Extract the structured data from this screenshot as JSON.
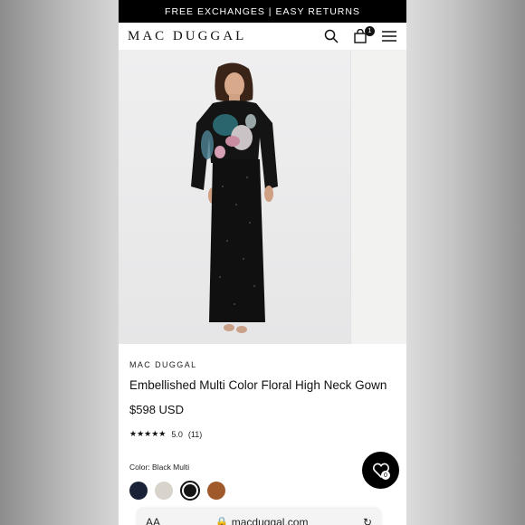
{
  "promo": {
    "text": "FREE EXCHANGES | EASY RETURNS"
  },
  "header": {
    "logo": "MAC DUGGAL",
    "cart_count": "1",
    "icons": [
      "search-icon",
      "cart-icon",
      "menu-icon"
    ]
  },
  "product": {
    "brand": "MAC DUGGAL",
    "title": "Embellished Multi Color Floral High Neck Gown",
    "price": "$598 USD",
    "stars": "★★★★★",
    "rating_value": "5.0",
    "review_count": "(11)",
    "color_label": "Color: Black Multi",
    "swatches": [
      {
        "name": "navy",
        "color": "#1a2238"
      },
      {
        "name": "silver",
        "color": "#d8d4cc"
      },
      {
        "name": "black-multi",
        "color": "#151515",
        "selected": true
      },
      {
        "name": "copper",
        "color": "#a0592a"
      }
    ]
  },
  "wishlist": {
    "count": "0"
  },
  "browser": {
    "aa": "AA",
    "url": "macduggal.com"
  }
}
